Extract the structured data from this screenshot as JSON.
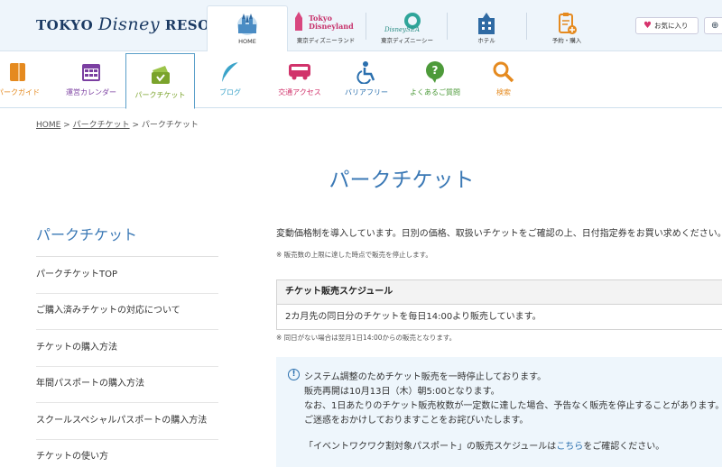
{
  "header": {
    "logo": {
      "pre": "TOKYO ",
      "disney": "Disney",
      "post": " RESORT",
      "reg": "®"
    },
    "tabs": [
      {
        "label": "HOME"
      },
      {
        "label": "東京ディズニーランド",
        "logo_line1": "Tokyo",
        "logo_line2": "Disneyland"
      },
      {
        "label": "東京ディズニーシー",
        "logo_text": "DisneySEA"
      },
      {
        "label": "ホテル"
      },
      {
        "label": "予約・購入"
      }
    ],
    "favorite_label": "お気に入り"
  },
  "nav": {
    "items": [
      {
        "label": "パークガイド",
        "icon": "map-icon",
        "color": "#e58a1f"
      },
      {
        "label": "運営カレンダー",
        "icon": "calendar-icon",
        "color": "#7b3fa1"
      },
      {
        "label": "パークチケット",
        "icon": "ticket-icon",
        "color": "#7aa32b"
      },
      {
        "label": "ブログ",
        "icon": "feather-icon",
        "color": "#3aa3c9"
      },
      {
        "label": "交通アクセス",
        "icon": "bus-icon",
        "color": "#d1336b"
      },
      {
        "label": "バリアフリー",
        "icon": "wheelchair-icon",
        "color": "#2a6fae"
      },
      {
        "label": "よくあるご質問",
        "icon": "question-bubble-icon",
        "color": "#4d9a3a"
      },
      {
        "label": "検索",
        "icon": "search-icon",
        "color": "#e58a1f"
      }
    ]
  },
  "breadcrumb": {
    "home": "HOME",
    "sep1": " > ",
    "link1": "パークチケット",
    "sep2": " > ",
    "current": "パークチケット"
  },
  "page_title": "パークチケット",
  "sidebar": {
    "title": "パークチケット",
    "items": [
      {
        "label": "パークチケットTOP"
      },
      {
        "label": "ご購入済みチケットの対応について"
      },
      {
        "label": "チケットの購入方法"
      },
      {
        "label": "年間パスポートの購入方法"
      },
      {
        "label": "スクールスペシャルパスポートの購入方法"
      },
      {
        "label": "チケットの使い方"
      }
    ]
  },
  "main": {
    "intro": "変動価格制を導入しています。日別の価格、取扱いチケットをご確認の上、日付指定券をお買い求めください。",
    "note1": "※ 販売数の上限に達した時点で販売を停止します。",
    "schedule": {
      "heading": "チケット販売スケジュール",
      "body": "2カ月先の同日分のチケットを毎日14:00より販売しています。"
    },
    "note2": "※ 同日がない場合は翌月1日14:00からの販売となります。",
    "info": {
      "line1": "システム調整のためチケット販売を一時停止しております。",
      "line2": "販売再開は10月13日（木）朝5:00となります。",
      "line3": "なお、1日あたりのチケット販売枚数が一定数に達した場合、予告なく販売を停止することがあります。",
      "line4": "ご迷惑をおかけしておりますことをお詫びいたします。",
      "line5_pre": "「イベントワクワク割対象パスポート」の販売スケジュールは",
      "line5_link": "こちら",
      "line5_post": "をご確認ください。"
    }
  },
  "colors": {
    "accent_blue": "#3a78b5",
    "info_bg": "#eef6fc",
    "header_bg": "#eef5fb"
  }
}
